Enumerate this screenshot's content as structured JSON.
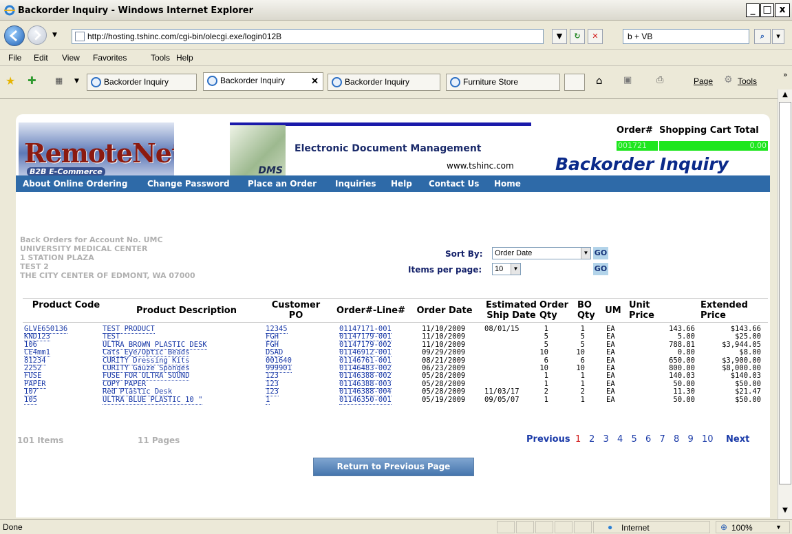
{
  "window": {
    "title": "Backorder Inquiry - Windows Internet Explorer",
    "min": "_",
    "max": "□",
    "close": "x"
  },
  "address": {
    "url": "http://hosting.tshinc.com/cgi-bin/olecgi.exe/login012B",
    "search": "b + VB",
    "refresh": "↻",
    "stop": "✕"
  },
  "menu": [
    "File",
    "Edit",
    "View",
    "Favorites",
    "Tools",
    "Help"
  ],
  "tabs": [
    {
      "label": "Backorder Inquiry"
    },
    {
      "label": "Backorder Inquiry"
    },
    {
      "label": "Backorder Inquiry"
    },
    {
      "label": "Furniture Store"
    }
  ],
  "toolbar": {
    "page": "Page",
    "tools": "Tools"
  },
  "header": {
    "logo_text": "RemoteNet",
    "logo_sub": "B2B E-Commerce",
    "dms": "DMS",
    "edm": "Electronic Document Management",
    "www": "www.tshinc.com",
    "order_label": "Order#",
    "cart_label": "Shopping Cart Total",
    "order_value": "001721",
    "cart_value": "0.00",
    "page_title": "Backorder Inquiry"
  },
  "nav": [
    "About Online Ordering",
    "Change Password",
    "Place an Order",
    "Inquiries",
    "Help",
    "Contact Us",
    "Home"
  ],
  "account": {
    "lines": [
      "Back Orders for Account No. UMC",
      "UNIVERSITY MEDICAL CENTER",
      "1 STATION PLAZA",
      "TEST 2",
      "THE CITY CENTER OF EDMONT, WA 07000"
    ]
  },
  "sort": {
    "label": "Sort By:",
    "value": "Order Date",
    "ipp_label": "Items per page:",
    "ipp_value": "10",
    "go": "GO"
  },
  "columns": {
    "code": "Product Code",
    "desc": "Product Description",
    "po": "Customer PO",
    "order": "Order#-Line#",
    "date": "Order Date",
    "ship": "Estimated Ship Date",
    "oqty": "Order Qty",
    "boqty": "BO Qty",
    "um": "UM",
    "unit": "Unit Price",
    "ext": "Extended Price"
  },
  "rows": [
    {
      "code": "GLVE650136",
      "desc": "TEST PRODUCT",
      "po": "12345",
      "order": "01147171-001",
      "date": "11/10/2009",
      "ship": "08/01/15",
      "oqty": "1",
      "boqty": "1",
      "um": "EA",
      "unit": "143.66",
      "ext": "$143.66"
    },
    {
      "code": "KND123",
      "desc": "TEST",
      "po": "FGH",
      "order": "01147179-001",
      "date": "11/10/2009",
      "ship": "",
      "oqty": "5",
      "boqty": "5",
      "um": "EA",
      "unit": "5.00",
      "ext": "$25.00"
    },
    {
      "code": "106",
      "desc": "ULTRA BROWN PLASTIC DESK",
      "po": "FGH",
      "order": "01147179-002",
      "date": "11/10/2009",
      "ship": "",
      "oqty": "5",
      "boqty": "5",
      "um": "EA",
      "unit": "788.81",
      "ext": "$3,944.05"
    },
    {
      "code": "CE4mm1",
      "desc": "Cats Eye/Optic Beads",
      "po": "DSAD",
      "order": "01146912-001",
      "date": "09/29/2009",
      "ship": "",
      "oqty": "10",
      "boqty": "10",
      "um": "EA",
      "unit": "0.80",
      "ext": "$8.00"
    },
    {
      "code": "81234",
      "desc": "CURITY Dressing Kits",
      "po": "001640",
      "order": "01146761-001",
      "date": "08/21/2009",
      "ship": "",
      "oqty": "6",
      "boqty": "6",
      "um": "EA",
      "unit": "650.00",
      "ext": "$3,900.00"
    },
    {
      "code": "2252",
      "desc": "CURITY Gauze Sponges",
      "po": "999901",
      "order": "01146483-002",
      "date": "06/23/2009",
      "ship": "",
      "oqty": "10",
      "boqty": "10",
      "um": "EA",
      "unit": "800.00",
      "ext": "$8,000.00"
    },
    {
      "code": "FUSE",
      "desc": "FUSE FOR ULTRA SOUND",
      "po": "123",
      "order": "01146388-002",
      "date": "05/28/2009",
      "ship": "",
      "oqty": "1",
      "boqty": "1",
      "um": "EA",
      "unit": "140.03",
      "ext": "$140.03"
    },
    {
      "code": "PAPER",
      "desc": "COPY PAPER",
      "po": "123",
      "order": "01146388-003",
      "date": "05/28/2009",
      "ship": "",
      "oqty": "1",
      "boqty": "1",
      "um": "EA",
      "unit": "50.00",
      "ext": "$50.00"
    },
    {
      "code": "107",
      "desc": "Red Plastic Desk",
      "po": "123",
      "order": "01146388-004",
      "date": "05/28/2009",
      "ship": "11/03/17",
      "oqty": "2",
      "boqty": "2",
      "um": "EA",
      "unit": "11.30",
      "ext": "$21.47"
    },
    {
      "code": "105",
      "desc": "ULTRA BLUE PLASTIC 10 \"",
      "po": "1",
      "order": "01146350-001",
      "date": "05/19/2009",
      "ship": "09/05/07",
      "oqty": "1",
      "boqty": "1",
      "um": "EA",
      "unit": "50.00",
      "ext": "$50.00"
    }
  ],
  "pager": {
    "items": "101 Items",
    "pages": "11 Pages",
    "prev": "Previous",
    "current": "1",
    "pages_list": [
      "2",
      "3",
      "4",
      "5",
      "6",
      "7",
      "8",
      "9",
      "10"
    ],
    "next": "Next"
  },
  "return_button": "Return to Previous Page",
  "status": {
    "text": "Done",
    "zone": "Internet",
    "zoom": "100%"
  }
}
